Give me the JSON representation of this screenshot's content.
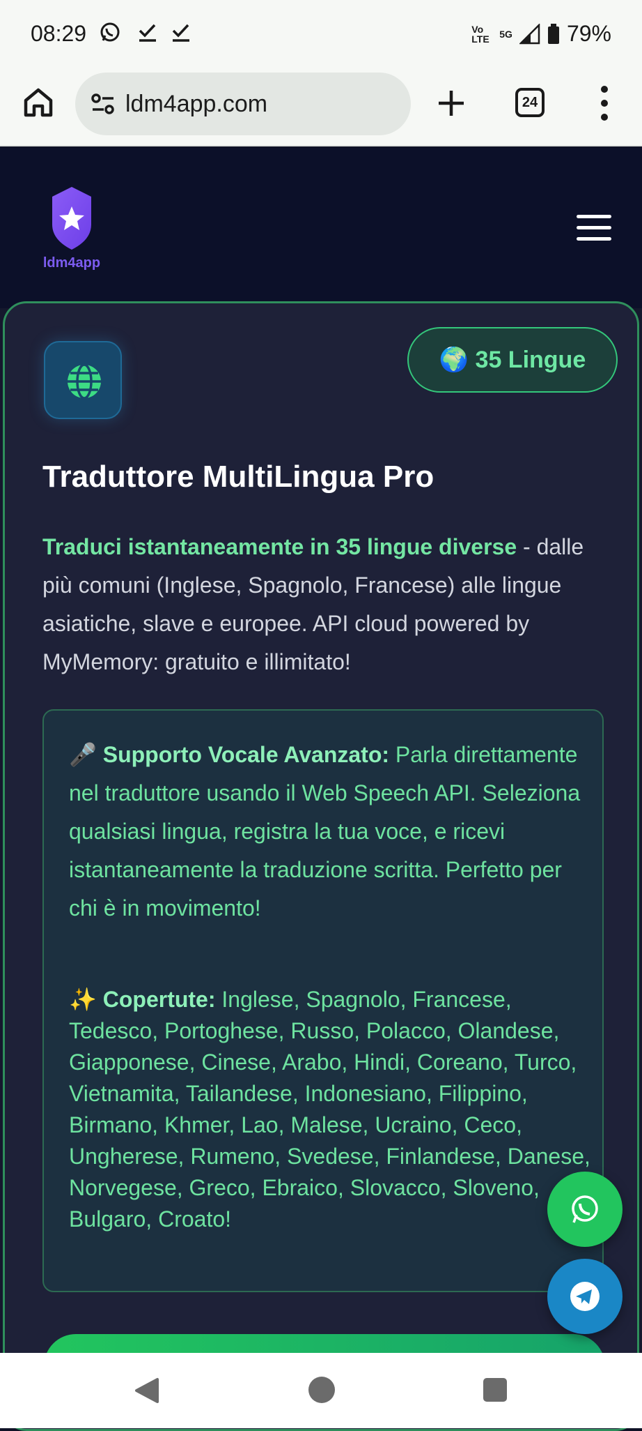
{
  "status_bar": {
    "time": "08:29",
    "network_label": "Vo LTE",
    "network_type": "5G",
    "battery": "79%"
  },
  "browser": {
    "url": "ldm4app.com",
    "tab_count": "24"
  },
  "site": {
    "logo_text": "ldm4app"
  },
  "card": {
    "badge_label": "🌍 35 Lingue",
    "title": "Traduttore MultiLingua Pro",
    "description_highlight": "Traduci istantaneamente in 35 lingue diverse",
    "description_rest": " - dalle più comuni (Inglese, Spagnolo, Francese) alle lingue asiatiche, slave e europee. API cloud powered by MyMemory: gratuito e illimitato!",
    "voice_emoji": "🎤",
    "voice_label": "Supporto Vocale Avanzato:",
    "voice_text": " Parla direttamente nel traduttore usando il Web Speech API. Seleziona qualsiasi lingua, registra la tua voce, e ricevi istantaneamente la traduzione scritta. Perfetto per chi è in movimento!",
    "coverage_emoji": "✨",
    "coverage_label": "Copertute:",
    "coverage_text": " Inglese, Spagnolo, Francese, Tedesco, Portoghese, Russo, Polacco, Olandese, Giapponese, Cinese, Arabo, Hindi, Coreano, Turco, Vietnamita, Tailandese, Indonesiano, Filippino, Birmano, Khmer, Lao, Malese, Ucraino, Ceco, Ungherese, Rumeno, Svedese, Finlandese, Danese, Norvegese, Greco, Ebraico, Slovacco, Sloveno, Bulgaro, Croato!"
  },
  "colors": {
    "accent_green": "#6ee7a4",
    "header_bg": "#0c1029",
    "card_bg": "#1e2138",
    "whatsapp": "#22c55e",
    "telegram": "#1a87c6"
  },
  "icons": [
    "whatsapp-icon",
    "check-icon",
    "home-icon",
    "site-settings-icon",
    "plus-icon",
    "tab-switcher-icon",
    "more-vert-icon",
    "logo-star-icon",
    "hamburger-icon",
    "globe-icon",
    "telegram-icon",
    "nav-back-icon",
    "nav-home-icon",
    "nav-recent-icon"
  ]
}
